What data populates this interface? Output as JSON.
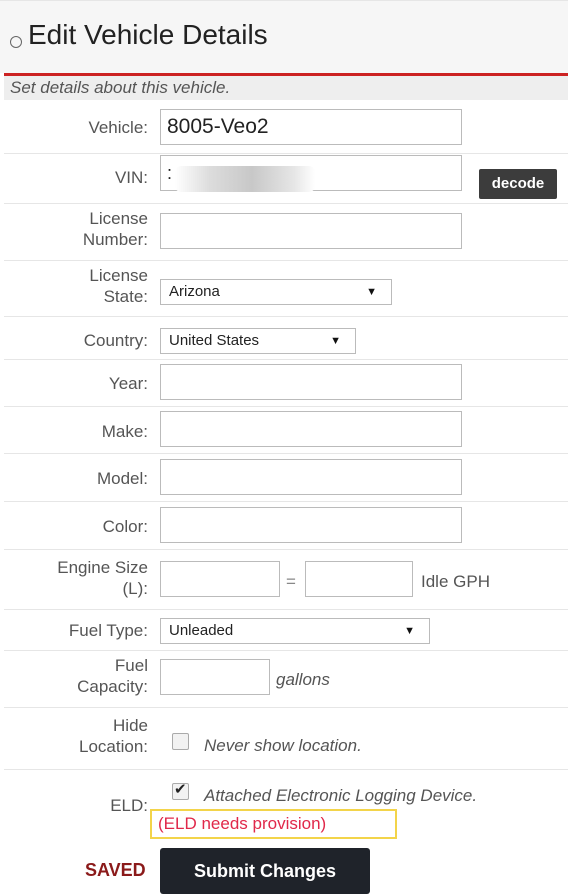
{
  "header": {
    "title": "Edit Vehicle Details",
    "icon": "globe-icon"
  },
  "description": "Set details about this vehicle.",
  "fields": {
    "vehicle": {
      "label": "Vehicle:",
      "value": "8005-Veo2"
    },
    "vin": {
      "label": "VIN:",
      "value": ":",
      "decode_label": "decode"
    },
    "license_number": {
      "label_line1": "License",
      "label_line2": "Number:",
      "value": ""
    },
    "license_state": {
      "label_line1": "License",
      "label_line2": "State:",
      "selected": "Arizona"
    },
    "country": {
      "label": "Country:",
      "selected": "United States"
    },
    "year": {
      "label": "Year:",
      "value": ""
    },
    "make": {
      "label": "Make:",
      "value": ""
    },
    "model": {
      "label": "Model:",
      "value": ""
    },
    "color": {
      "label": "Color:",
      "value": ""
    },
    "engine_size": {
      "label_line1": "Engine Size",
      "label_line2": "(L):",
      "equals": "=",
      "idle_label": "Idle GPH"
    },
    "fuel_type": {
      "label": "Fuel Type:",
      "selected": "Unleaded"
    },
    "fuel_capacity": {
      "label_line1": "Fuel",
      "label_line2": "Capacity:",
      "unit": "gallons"
    },
    "hide_location": {
      "label_line1": "Hide",
      "label_line2": "Location:",
      "checkbox_label": "Never show location.",
      "checked": false
    },
    "eld": {
      "label": "ELD:",
      "checkbox_label": "Attached Electronic Logging Device.",
      "checked": true,
      "status": "(ELD needs provision)"
    }
  },
  "footer": {
    "saved": "SAVED",
    "submit": "Submit Changes"
  },
  "colors": {
    "accent_red": "#cc2222",
    "status_red": "#e0284a",
    "highlight_yellow": "#f3d44a",
    "button_dark": "#1f232a",
    "saved_red": "#8b1a1a"
  }
}
